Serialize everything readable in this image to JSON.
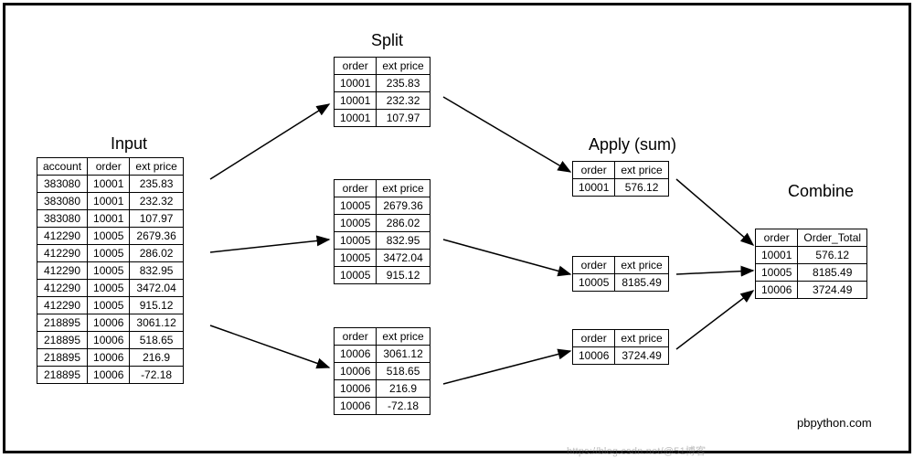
{
  "titles": {
    "input": "Input",
    "split": "Split",
    "apply": "Apply (sum)",
    "combine": "Combine"
  },
  "headers": {
    "account": "account",
    "order": "order",
    "ext_price": "ext price",
    "order_total": "Order_Total"
  },
  "input_rows": [
    {
      "account": "383080",
      "order": "10001",
      "ext_price": "235.83"
    },
    {
      "account": "383080",
      "order": "10001",
      "ext_price": "232.32"
    },
    {
      "account": "383080",
      "order": "10001",
      "ext_price": "107.97"
    },
    {
      "account": "412290",
      "order": "10005",
      "ext_price": "2679.36"
    },
    {
      "account": "412290",
      "order": "10005",
      "ext_price": "286.02"
    },
    {
      "account": "412290",
      "order": "10005",
      "ext_price": "832.95"
    },
    {
      "account": "412290",
      "order": "10005",
      "ext_price": "3472.04"
    },
    {
      "account": "412290",
      "order": "10005",
      "ext_price": "915.12"
    },
    {
      "account": "218895",
      "order": "10006",
      "ext_price": "3061.12"
    },
    {
      "account": "218895",
      "order": "10006",
      "ext_price": "518.65"
    },
    {
      "account": "218895",
      "order": "10006",
      "ext_price": "216.9"
    },
    {
      "account": "218895",
      "order": "10006",
      "ext_price": "-72.18"
    }
  ],
  "split_groups": [
    {
      "rows": [
        {
          "order": "10001",
          "ext_price": "235.83"
        },
        {
          "order": "10001",
          "ext_price": "232.32"
        },
        {
          "order": "10001",
          "ext_price": "107.97"
        }
      ]
    },
    {
      "rows": [
        {
          "order": "10005",
          "ext_price": "2679.36"
        },
        {
          "order": "10005",
          "ext_price": "286.02"
        },
        {
          "order": "10005",
          "ext_price": "832.95"
        },
        {
          "order": "10005",
          "ext_price": "3472.04"
        },
        {
          "order": "10005",
          "ext_price": "915.12"
        }
      ]
    },
    {
      "rows": [
        {
          "order": "10006",
          "ext_price": "3061.12"
        },
        {
          "order": "10006",
          "ext_price": "518.65"
        },
        {
          "order": "10006",
          "ext_price": "216.9"
        },
        {
          "order": "10006",
          "ext_price": "-72.18"
        }
      ]
    }
  ],
  "apply_rows": [
    {
      "order": "10001",
      "ext_price": "576.12"
    },
    {
      "order": "10005",
      "ext_price": "8185.49"
    },
    {
      "order": "10006",
      "ext_price": "3724.49"
    }
  ],
  "combine_rows": [
    {
      "order": "10001",
      "order_total": "576.12"
    },
    {
      "order": "10005",
      "order_total": "8185.49"
    },
    {
      "order": "10006",
      "order_total": "3724.49"
    }
  ],
  "credit": "pbpython.com",
  "watermark": "https://blog.csdn.net/@51博客"
}
